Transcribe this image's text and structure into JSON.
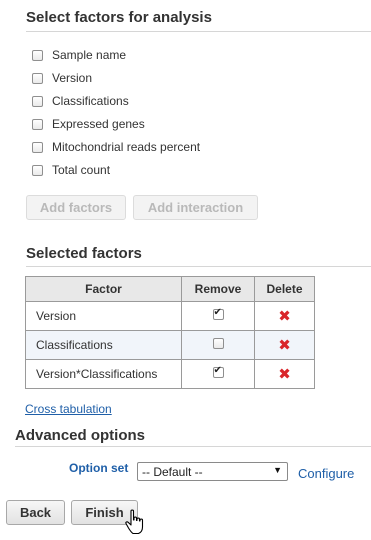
{
  "select_factors": {
    "title": "Select factors for analysis",
    "options": [
      {
        "label": "Sample name",
        "checked": false
      },
      {
        "label": "Version",
        "checked": false
      },
      {
        "label": "Classifications",
        "checked": false
      },
      {
        "label": "Expressed genes",
        "checked": false
      },
      {
        "label": "Mitochondrial reads percent",
        "checked": false
      },
      {
        "label": "Total count",
        "checked": false
      }
    ],
    "add_factors_label": "Add factors",
    "add_interaction_label": "Add interaction"
  },
  "selected_factors": {
    "title": "Selected factors",
    "columns": [
      "Factor",
      "Remove",
      "Delete"
    ],
    "rows": [
      {
        "factor": "Version",
        "remove": true
      },
      {
        "factor": "Classifications",
        "remove": false
      },
      {
        "factor": "Version*Classifications",
        "remove": true
      }
    ],
    "delete_glyph": "✖",
    "delete_color": "#d9262b"
  },
  "cross_tabulation_label": "Cross tabulation",
  "advanced": {
    "title": "Advanced options",
    "option_set_label": "Option set",
    "option_set_value": "-- Default --",
    "configure_label": "Configure"
  },
  "footer": {
    "back_label": "Back",
    "finish_label": "Finish"
  },
  "colors": {
    "link": "#1f5fa8",
    "delete": "#d9262b"
  }
}
